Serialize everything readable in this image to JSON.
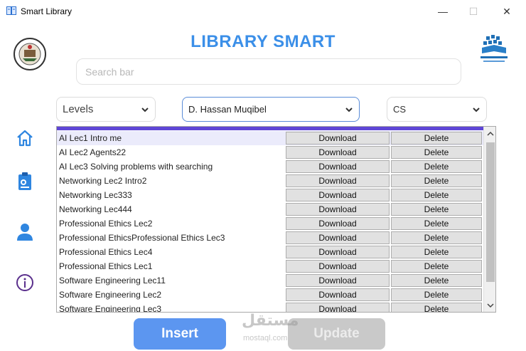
{
  "window": {
    "title": "Smart Library",
    "minimize_glyph": "—",
    "maximize_glyph": "☐",
    "close_glyph": "✕"
  },
  "header": {
    "title": "LIBRARY SMART"
  },
  "search": {
    "placeholder": "Search bar",
    "value": ""
  },
  "filters": {
    "level": "Levels",
    "doctor": "D. Hassan Muqibel",
    "department": "CS"
  },
  "nav": {
    "items": [
      {
        "icon": "home-icon"
      },
      {
        "icon": "clipboard-icon"
      },
      {
        "icon": "user-icon"
      },
      {
        "icon": "info-icon"
      }
    ]
  },
  "table": {
    "download_label": "Download",
    "delete_label": "Delete",
    "selected_index": 0,
    "rows": [
      "AI Lec1 Intro me",
      "AI Lec2 Agents22",
      "AI Lec3 Solving problems with searching",
      "Networking Lec2 Intro2",
      "Networking Lec333",
      "Networking Lec444",
      "Professional Ethics Lec2",
      "Professional EthicsProfessional Ethics Lec3",
      "Professional Ethics Lec4",
      "Professional Ethics Lec1",
      "Software Engineering Lec11",
      "Software Engineering Lec2",
      "Software Engineering Lec3"
    ]
  },
  "actions": {
    "insert_label": "Insert",
    "update_label": "Update"
  },
  "watermark": {
    "arabic": "مستقل",
    "latin": "mostaql.com"
  },
  "colors": {
    "accent": "#3b8fe8",
    "insert_bg": "#5c96f0",
    "update_bg": "#c9c9c9",
    "table_header": "#5f46d6",
    "nav_icon": "#2f86e0",
    "info_icon": "#5a2f8c"
  }
}
